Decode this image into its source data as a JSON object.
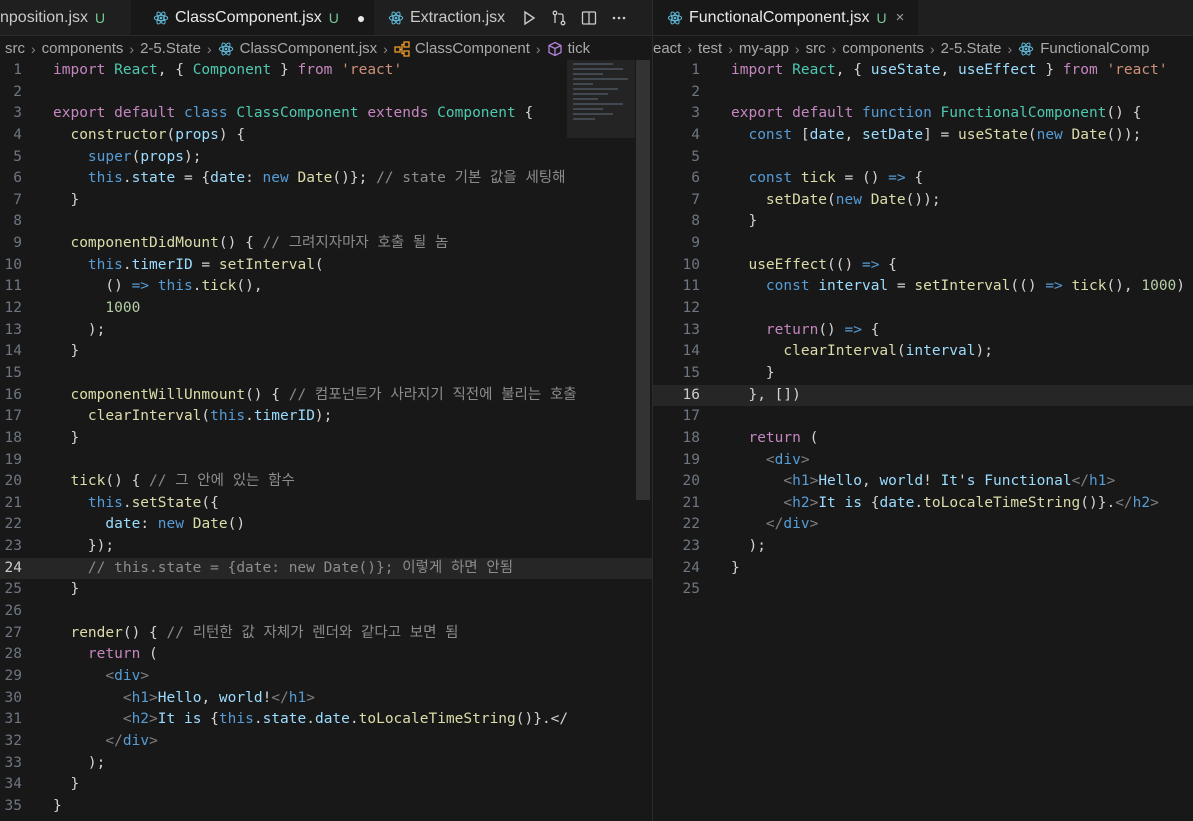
{
  "left_pane": {
    "tabs": [
      {
        "label": "nposition.jsx",
        "status": "U"
      },
      {
        "label": "ClassComponent.jsx",
        "status": "U",
        "modified_dot": "●"
      },
      {
        "label": "Extraction.jsx"
      }
    ],
    "actions": [
      "run-icon",
      "compare-icon",
      "split-editor-icon",
      "more-icon"
    ],
    "breadcrumbs": [
      "src",
      "components",
      "2-5.State",
      "ClassComponent.jsx",
      "ClassComponent",
      "tick"
    ],
    "current_line": 24,
    "code_lines": [
      "import React, { Component } from 'react'",
      "",
      "export default class ClassComponent extends Component {",
      "  constructor(props) {",
      "    super(props);",
      "    this.state = {date: new Date()}; // state 기본 값을 세팅해 ",
      "  }",
      "",
      "  componentDidMount() { // 그려지자마자 호출 될 놈",
      "    this.timerID = setInterval(",
      "      () => this.tick(),",
      "      1000",
      "    );",
      "  }",
      "",
      "  componentWillUnmount() { // 컴포넌트가 사라지기 직전에 불리는 호출",
      "    clearInterval(this.timerID);",
      "  }",
      "",
      "  tick() { // 그 안에 있는 함수",
      "    this.setState({",
      "      date: new Date()",
      "    });",
      "    // this.state = {date: new Date()}; 이렇게 하면 안됨",
      "  }",
      "",
      "  render() { // 리턴한 값 자체가 렌더와 같다고 보면 됨",
      "    return (",
      "      <div>",
      "        <h1>Hello, world!</h1>",
      "        <h2>It is {this.state.date.toLocaleTimeString()}.</",
      "      </div>",
      "    );",
      "  }",
      "}"
    ]
  },
  "right_pane": {
    "tabs": [
      {
        "label": "FunctionalComponent.jsx",
        "status": "U",
        "close": "×"
      }
    ],
    "breadcrumbs": [
      "eact",
      "test",
      "my-app",
      "src",
      "components",
      "2-5.State",
      "FunctionalComp"
    ],
    "current_line": 16,
    "code_lines": [
      "import React, { useState, useEffect } from 'react'",
      "",
      "export default function FunctionalComponent() {",
      "  const [date, setDate] = useState(new Date());",
      "",
      "  const tick = () => {",
      "    setDate(new Date());",
      "  }",
      "",
      "  useEffect(() => {",
      "    const interval = setInterval(() => tick(), 1000)",
      "",
      "    return() => {",
      "      clearInterval(interval);",
      "    }",
      "  }, [])",
      "",
      "  return (",
      "    <div>",
      "      <h1>Hello, world! It's Functional</h1>",
      "      <h2>It is {date.toLocaleTimeString()}.</h2>",
      "    </div>",
      "  );",
      "}",
      ""
    ]
  },
  "colors": {
    "editor_bg": "#181818",
    "keyword": "#c586c0",
    "storage": "#569cd6",
    "function": "#dcdcaa",
    "string": "#ce9178",
    "variable": "#9cdcfe",
    "number": "#b5cea8",
    "comment": "#8c8c8c",
    "type": "#4ec9b0",
    "untracked": "#73c991"
  }
}
